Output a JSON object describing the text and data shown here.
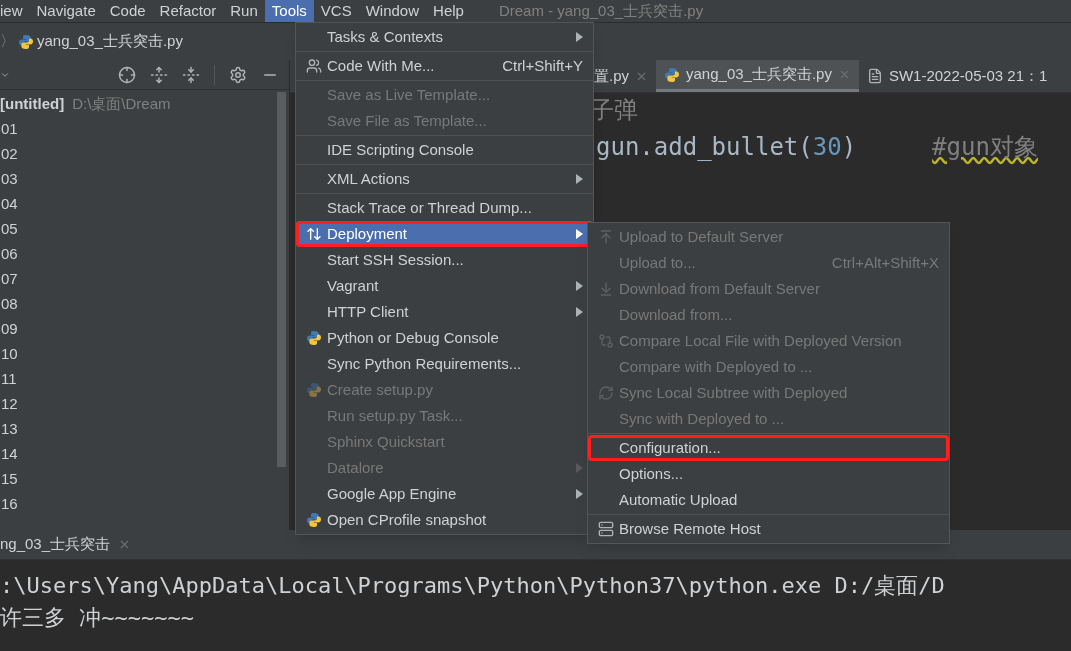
{
  "menu_bar": {
    "items": [
      {
        "label": "iew",
        "selected": false
      },
      {
        "label": "Navigate",
        "selected": false
      },
      {
        "label": "Code",
        "selected": false
      },
      {
        "label": "Refactor",
        "selected": false
      },
      {
        "label": "Run",
        "selected": false
      },
      {
        "label": "Tools",
        "selected": true
      },
      {
        "label": "VCS",
        "selected": false
      },
      {
        "label": "Window",
        "selected": false
      },
      {
        "label": "Help",
        "selected": false
      }
    ],
    "title": "Dream - yang_03_士兵突击.py"
  },
  "breadcrumb": {
    "separator": "〉",
    "file": "yang_03_士兵突击.py"
  },
  "project_panel": {
    "root": {
      "label": "[untitled]",
      "path": "D:\\桌面\\Dream"
    },
    "rows": [
      "01",
      "02",
      "03",
      "04",
      "05",
      "06",
      "07",
      "08",
      "09",
      "10",
      "11",
      "12",
      "13",
      "14",
      "15",
      "16"
    ]
  },
  "editor": {
    "tabs": [
      {
        "label": "置.py",
        "selected": false,
        "kind": "plain",
        "closable": true
      },
      {
        "label": "yang_03_士兵突击.py",
        "selected": true,
        "kind": "python",
        "closable": true
      },
      {
        "label": "SW1-2022-05-03 21：1",
        "selected": false,
        "kind": "file",
        "closable": false
      }
    ],
    "lines": [
      {
        "kind": "comment",
        "text": "子弹"
      },
      {
        "kind": "code",
        "text": "gun.add_bullet(",
        "number": "30",
        "close": ")",
        "comment": "#gun对象"
      }
    ]
  },
  "tools_menu": {
    "groups": [
      [
        {
          "label": "Tasks & Contexts",
          "kind": "plain",
          "disabled": false,
          "submenu": true,
          "selected": false,
          "highlighted": false
        }
      ],
      [
        {
          "label": "Code With Me...",
          "kind": "people",
          "shortcut": "Ctrl+Shift+Y",
          "disabled": false,
          "submenu": false,
          "selected": false,
          "highlighted": false
        }
      ],
      [
        {
          "label": "Save as Live Template...",
          "kind": "plain",
          "disabled": true,
          "submenu": false,
          "selected": false,
          "highlighted": false
        },
        {
          "label": "Save File as Template...",
          "kind": "plain",
          "disabled": true,
          "submenu": false,
          "selected": false,
          "highlighted": false
        }
      ],
      [
        {
          "label": "IDE Scripting Console",
          "kind": "plain",
          "disabled": false,
          "submenu": false,
          "selected": false,
          "highlighted": false
        }
      ],
      [
        {
          "label": "XML Actions",
          "kind": "plain",
          "disabled": false,
          "submenu": true,
          "selected": false,
          "highlighted": false
        }
      ],
      [
        {
          "label": "Stack Trace or Thread Dump...",
          "kind": "plain",
          "disabled": false,
          "submenu": false,
          "selected": false,
          "highlighted": false
        },
        {
          "label": "Deployment",
          "kind": "deploy",
          "disabled": false,
          "submenu": true,
          "selected": true,
          "highlighted": true
        },
        {
          "label": "Start SSH Session...",
          "kind": "plain",
          "disabled": false,
          "submenu": false,
          "selected": false,
          "highlighted": false
        },
        {
          "label": "Vagrant",
          "kind": "plain",
          "disabled": false,
          "submenu": true,
          "selected": false,
          "highlighted": false
        },
        {
          "label": "HTTP Client",
          "kind": "plain",
          "disabled": false,
          "submenu": true,
          "selected": false,
          "highlighted": false
        },
        {
          "label": "Python or Debug Console",
          "kind": "python",
          "disabled": false,
          "submenu": false,
          "selected": false,
          "highlighted": false
        },
        {
          "label": "Sync Python Requirements...",
          "kind": "plain",
          "disabled": false,
          "submenu": false,
          "selected": false,
          "highlighted": false
        },
        {
          "label": "Create setup.py",
          "kind": "python",
          "disabled": true,
          "submenu": false,
          "selected": false,
          "highlighted": false
        },
        {
          "label": "Run setup.py Task...",
          "kind": "plain",
          "disabled": true,
          "submenu": false,
          "selected": false,
          "highlighted": false
        },
        {
          "label": "Sphinx Quickstart",
          "kind": "plain",
          "disabled": true,
          "submenu": false,
          "selected": false,
          "highlighted": false
        },
        {
          "label": "Datalore",
          "kind": "plain",
          "disabled": true,
          "submenu": true,
          "selected": false,
          "highlighted": false
        },
        {
          "label": "Google App Engine",
          "kind": "plain",
          "disabled": false,
          "submenu": true,
          "selected": false,
          "highlighted": false
        },
        {
          "label": "Open CProfile snapshot",
          "kind": "python",
          "disabled": false,
          "submenu": false,
          "selected": false,
          "highlighted": false
        }
      ]
    ]
  },
  "deployment_menu": {
    "groups": [
      [
        {
          "label": "Upload to Default Server",
          "kind": "upload",
          "disabled": true,
          "submenu": false,
          "selected": false,
          "highlighted": false
        },
        {
          "label": "Upload to...",
          "kind": "plain",
          "shortcut": "Ctrl+Alt+Shift+X",
          "disabled": true,
          "submenu": false,
          "selected": false,
          "highlighted": false
        },
        {
          "label": "Download from Default Server",
          "kind": "download",
          "disabled": true,
          "submenu": false,
          "selected": false,
          "highlighted": false
        },
        {
          "label": "Download from...",
          "kind": "plain",
          "disabled": true,
          "submenu": false,
          "selected": false,
          "highlighted": false
        },
        {
          "label": "Compare Local File with Deployed Version",
          "kind": "compare",
          "disabled": true,
          "submenu": false,
          "selected": false,
          "highlighted": false
        },
        {
          "label": "Compare with Deployed to ...",
          "kind": "plain",
          "disabled": true,
          "submenu": false,
          "selected": false,
          "highlighted": false
        },
        {
          "label": "Sync Local Subtree with Deployed",
          "kind": "sync",
          "disabled": true,
          "submenu": false,
          "selected": false,
          "highlighted": false
        },
        {
          "label": "Sync with Deployed to ...",
          "kind": "plain",
          "disabled": true,
          "submenu": false,
          "selected": false,
          "highlighted": false
        }
      ],
      [
        {
          "label": "Configuration...",
          "kind": "plain",
          "disabled": false,
          "submenu": false,
          "selected": false,
          "highlighted": true
        },
        {
          "label": "Options...",
          "kind": "plain",
          "disabled": false,
          "submenu": false,
          "selected": false,
          "highlighted": false
        },
        {
          "label": "Automatic Upload",
          "kind": "plain",
          "disabled": false,
          "submenu": false,
          "selected": false,
          "highlighted": false
        }
      ],
      [
        {
          "label": "Browse Remote Host",
          "kind": "server",
          "disabled": false,
          "submenu": false,
          "selected": false,
          "highlighted": false
        }
      ]
    ]
  },
  "run_panel": {
    "tab": "ng_03_士兵突击",
    "output": [
      ":\\Users\\Yang\\AppData\\Local\\Programs\\Python\\Python37\\python.exe D:/桌面/D",
      "许三多   冲~~~~~~~"
    ]
  }
}
